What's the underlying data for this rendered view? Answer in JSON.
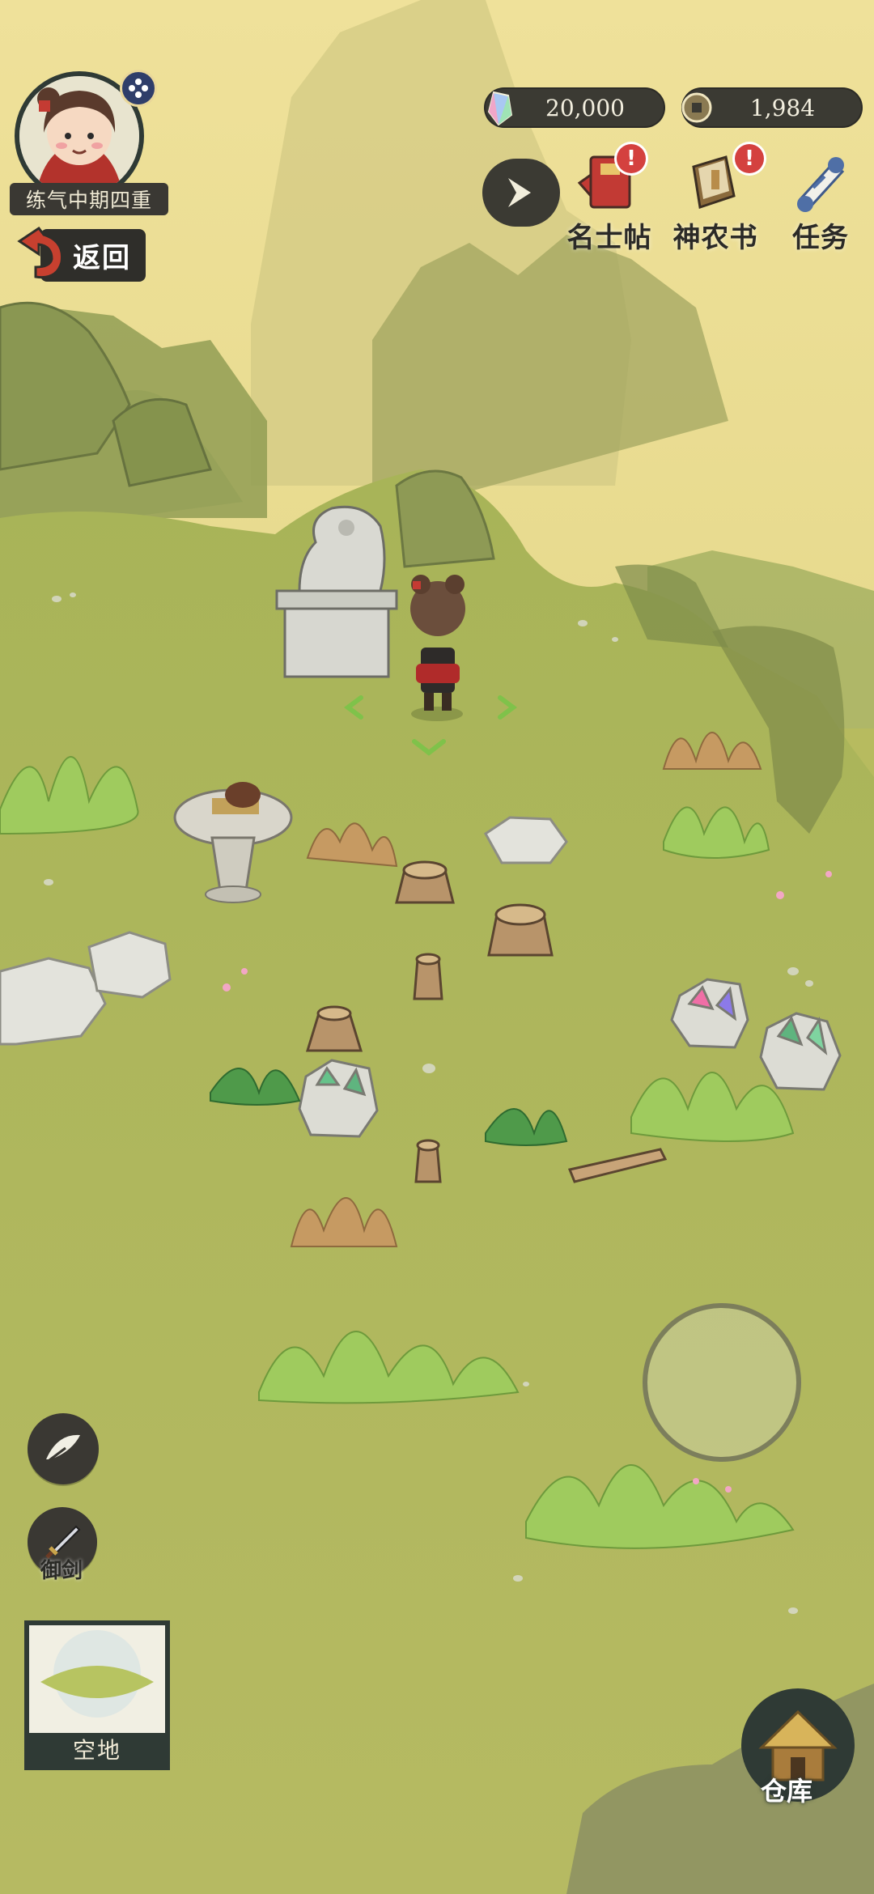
{
  "player": {
    "rank": "练气中期四重",
    "back_label": "返回"
  },
  "currencies": {
    "spirit_stone": "20,000",
    "copper_coin": "1,984"
  },
  "top_menu": [
    {
      "label": "名士帖",
      "badge": "!"
    },
    {
      "label": "神农书",
      "badge": "!"
    },
    {
      "label": "任务",
      "badge": ""
    }
  ],
  "side_buttons": {
    "fly_sword_label": "御剑"
  },
  "selection_card": {
    "label": "空地"
  },
  "warehouse": {
    "label": "仓库"
  },
  "icons": [
    "feather-icon",
    "sword-icon",
    "expand-arrow-icon",
    "red-book-icon",
    "shennong-book-icon",
    "scroll-icon",
    "crystal-icon",
    "coin-icon",
    "straw-hut-icon"
  ]
}
